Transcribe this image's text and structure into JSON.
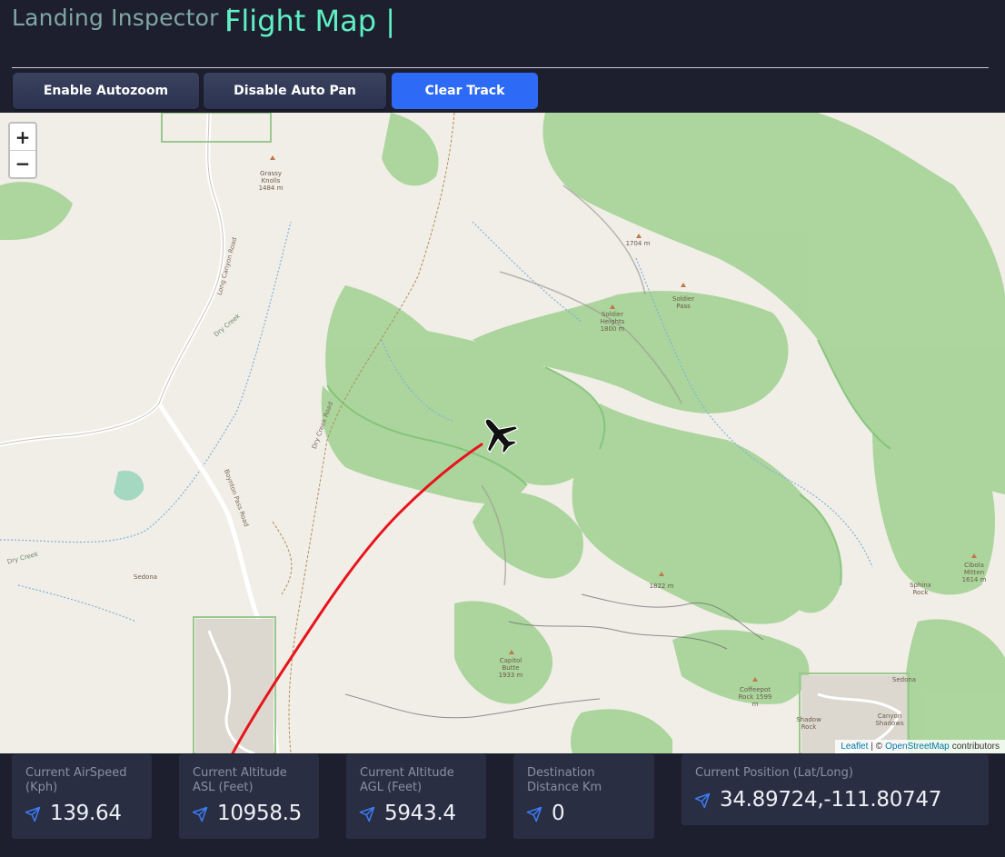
{
  "header": {
    "brand": "Landing Inspector |",
    "title": "Flight Map |"
  },
  "toolbar": {
    "autozoom_label": "Enable Autozoom",
    "autopan_label": "Disable Auto Pan",
    "clear_label": "Clear Track"
  },
  "map": {
    "zoom_in": "+",
    "zoom_out": "−",
    "attribution": {
      "leaflet": "Leaflet",
      "separator": "| ©",
      "osm": "OpenStreetMap",
      "suffix": "contributors"
    },
    "labels": {
      "grassy_knolls": "Grassy Knolls 1484 m",
      "peak_1704": "1704 m",
      "soldier_pass": "Soldier Pass",
      "soldier_heights": "Soldier Heights 1800 m",
      "peak_1822": "1822 m",
      "sedona_west": "Sedona",
      "sedona_east": "Sedona",
      "capitol_butte": "Capitol Butte 1933 m",
      "sphinx_rock": "Sphinx Rock",
      "coffeepot_rock": "Coffeepot Rock 1599 m",
      "cibola_mitten": "Cibola Mitten 1614 m",
      "shadow_rock": "Shadow Rock",
      "canyon_shadows": "Canyon Shadows",
      "dry_creek": "Dry Creek",
      "dry_creek_road": "Dry Creek Road",
      "long_canyon_road": "Long Canyon Road",
      "boynton_pass_road": "Boynton Pass Road"
    },
    "track_color": "#e8141c"
  },
  "stats": {
    "airspeed": {
      "label": "Current AirSpeed (Kph)",
      "value": "139.64",
      "icon": "send-icon"
    },
    "altitude_asl": {
      "label": "Current Altitude ASL (Feet)",
      "value": "10958.5",
      "icon": "send-icon"
    },
    "altitude_agl": {
      "label": "Current Altitude AGL (Feet)",
      "value": "5943.4",
      "icon": "send-icon"
    },
    "destination": {
      "label": "Destination Distance Km",
      "value": "0",
      "icon": "send-icon"
    },
    "position": {
      "label": "Current Position (Lat/Long)",
      "value": "34.89724,-111.80747",
      "icon": "send-icon"
    }
  },
  "colors": {
    "background": "#1e1f2e",
    "accent": "#5ef0c4",
    "button_blue": "#2d6af6",
    "card": "#2a2e42",
    "icon_blue": "#3b7df6"
  }
}
